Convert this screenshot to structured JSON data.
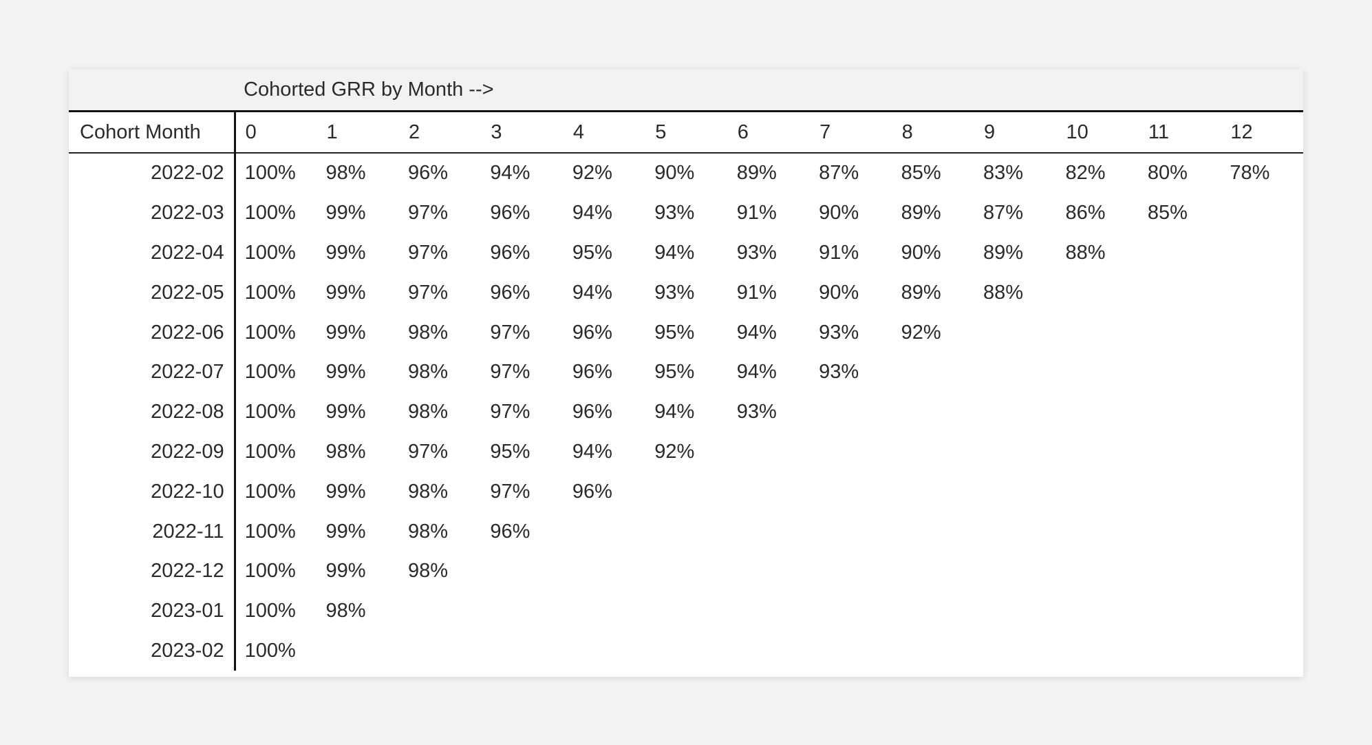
{
  "chart_data": {
    "type": "table",
    "title": "Cohorted GRR by Month -->",
    "row_header": "Cohort Month",
    "columns": [
      "0",
      "1",
      "2",
      "3",
      "4",
      "5",
      "6",
      "7",
      "8",
      "9",
      "10",
      "11",
      "12"
    ],
    "rows": [
      {
        "cohort": "2022-02",
        "values": [
          "100%",
          "98%",
          "96%",
          "94%",
          "92%",
          "90%",
          "89%",
          "87%",
          "85%",
          "83%",
          "82%",
          "80%",
          "78%"
        ]
      },
      {
        "cohort": "2022-03",
        "values": [
          "100%",
          "99%",
          "97%",
          "96%",
          "94%",
          "93%",
          "91%",
          "90%",
          "89%",
          "87%",
          "86%",
          "85%"
        ]
      },
      {
        "cohort": "2022-04",
        "values": [
          "100%",
          "99%",
          "97%",
          "96%",
          "95%",
          "94%",
          "93%",
          "91%",
          "90%",
          "89%",
          "88%"
        ]
      },
      {
        "cohort": "2022-05",
        "values": [
          "100%",
          "99%",
          "97%",
          "96%",
          "94%",
          "93%",
          "91%",
          "90%",
          "89%",
          "88%"
        ]
      },
      {
        "cohort": "2022-06",
        "values": [
          "100%",
          "99%",
          "98%",
          "97%",
          "96%",
          "95%",
          "94%",
          "93%",
          "92%"
        ]
      },
      {
        "cohort": "2022-07",
        "values": [
          "100%",
          "99%",
          "98%",
          "97%",
          "96%",
          "95%",
          "94%",
          "93%"
        ]
      },
      {
        "cohort": "2022-08",
        "values": [
          "100%",
          "99%",
          "98%",
          "97%",
          "96%",
          "94%",
          "93%"
        ]
      },
      {
        "cohort": "2022-09",
        "values": [
          "100%",
          "98%",
          "97%",
          "95%",
          "94%",
          "92%"
        ]
      },
      {
        "cohort": "2022-10",
        "values": [
          "100%",
          "99%",
          "98%",
          "97%",
          "96%"
        ]
      },
      {
        "cohort": "2022-11",
        "values": [
          "100%",
          "99%",
          "98%",
          "96%"
        ]
      },
      {
        "cohort": "2022-12",
        "values": [
          "100%",
          "99%",
          "98%"
        ]
      },
      {
        "cohort": "2023-01",
        "values": [
          "100%",
          "98%"
        ]
      },
      {
        "cohort": "2023-02",
        "values": [
          "100%"
        ]
      }
    ]
  }
}
